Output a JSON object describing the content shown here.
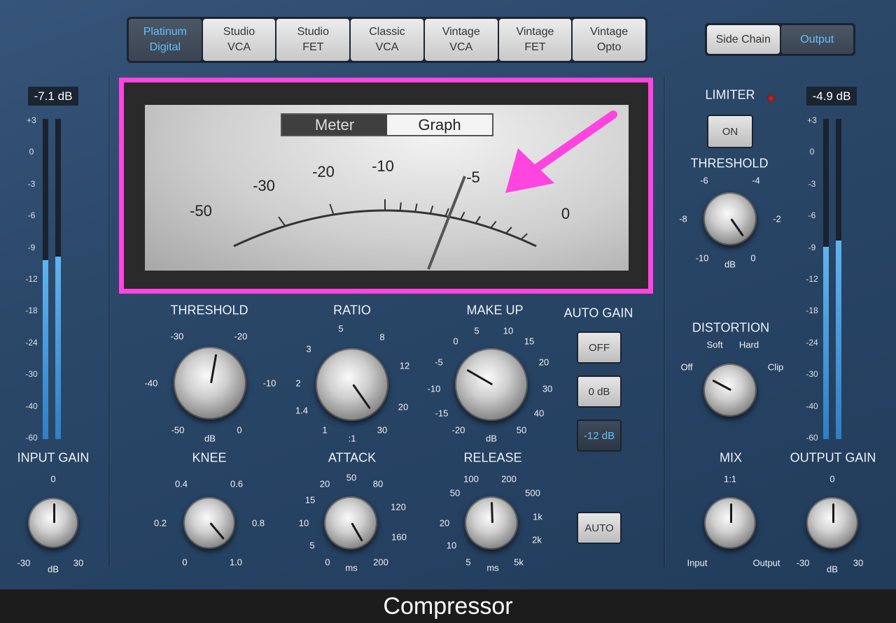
{
  "modes": [
    {
      "label": "Platinum\nDigital",
      "active": true
    },
    {
      "label": "Studio\nVCA",
      "active": false
    },
    {
      "label": "Studio\nFET",
      "active": false
    },
    {
      "label": "Classic\nVCA",
      "active": false
    },
    {
      "label": "Vintage\nVCA",
      "active": false
    },
    {
      "label": "Vintage\nFET",
      "active": false
    },
    {
      "label": "Vintage\nOpto",
      "active": false
    }
  ],
  "side_chain": {
    "label": "Side Chain"
  },
  "output_btn": {
    "label": "Output"
  },
  "meter": {
    "meter_label": "Meter",
    "graph_label": "Graph",
    "scale_labels": [
      "-50",
      "-30",
      "-20",
      "-10",
      "-5",
      "0"
    ],
    "needle_value_db": -4
  },
  "input": {
    "value": "-7.1 dB",
    "title": "INPUT GAIN",
    "min": "-30",
    "max": "30",
    "center": "0",
    "unit": "dB",
    "level_left": 0.56,
    "level_right": 0.57
  },
  "output": {
    "value": "-4.9 dB",
    "title": "OUTPUT GAIN",
    "min": "-30",
    "max": "30",
    "center": "0",
    "unit": "dB",
    "level_left": 0.6,
    "level_right": 0.62
  },
  "meter_scale": [
    "+3",
    "0",
    "-3",
    "-6",
    "-9",
    "-12",
    "-18",
    "-24",
    "-30",
    "-40",
    "-60"
  ],
  "threshold": {
    "title": "THRESHOLD",
    "labels": [
      "-30",
      "-20",
      "-40",
      "-10",
      "-50",
      "0"
    ],
    "unit": "dB"
  },
  "ratio": {
    "title": "RATIO",
    "labels": [
      "5",
      "8",
      "3",
      "12",
      "2",
      "20",
      "1.4",
      "1",
      "30"
    ],
    "unit": ":1"
  },
  "makeup": {
    "title": "MAKE UP",
    "labels": [
      "5",
      "10",
      "0",
      "15",
      "-5",
      "20",
      "-10",
      "30",
      "-15",
      "40",
      "-20",
      "50"
    ],
    "unit": "dB"
  },
  "auto_gain": {
    "title": "AUTO GAIN",
    "off": "OFF",
    "zero": "0 dB",
    "minus12": "-12 dB"
  },
  "knee": {
    "title": "KNEE",
    "labels": [
      "0.4",
      "0.6",
      "0.2",
      "0.8",
      "0",
      "1.0"
    ]
  },
  "attack": {
    "title": "ATTACK",
    "labels": [
      "50",
      "20",
      "80",
      "15",
      "120",
      "10",
      "160",
      "5",
      "0",
      "200"
    ],
    "unit": "ms"
  },
  "release": {
    "title": "RELEASE",
    "labels": [
      "100",
      "200",
      "50",
      "500",
      "20",
      "1k",
      "10",
      "2k",
      "5",
      "5k"
    ],
    "unit": "ms"
  },
  "auto_btn": {
    "label": "AUTO"
  },
  "limiter": {
    "title": "LIMITER",
    "on_label": "ON"
  },
  "limit_threshold": {
    "title": "THRESHOLD",
    "labels": [
      "-6",
      "-4",
      "-8",
      "-2",
      "-10",
      "0"
    ],
    "unit": "dB"
  },
  "distortion": {
    "title": "DISTORTION",
    "labels": [
      "Soft",
      "Hard",
      "Off",
      "Clip"
    ]
  },
  "mix": {
    "title": "MIX",
    "center": "1:1",
    "left": "Input",
    "right": "Output"
  },
  "caption": "Compressor"
}
